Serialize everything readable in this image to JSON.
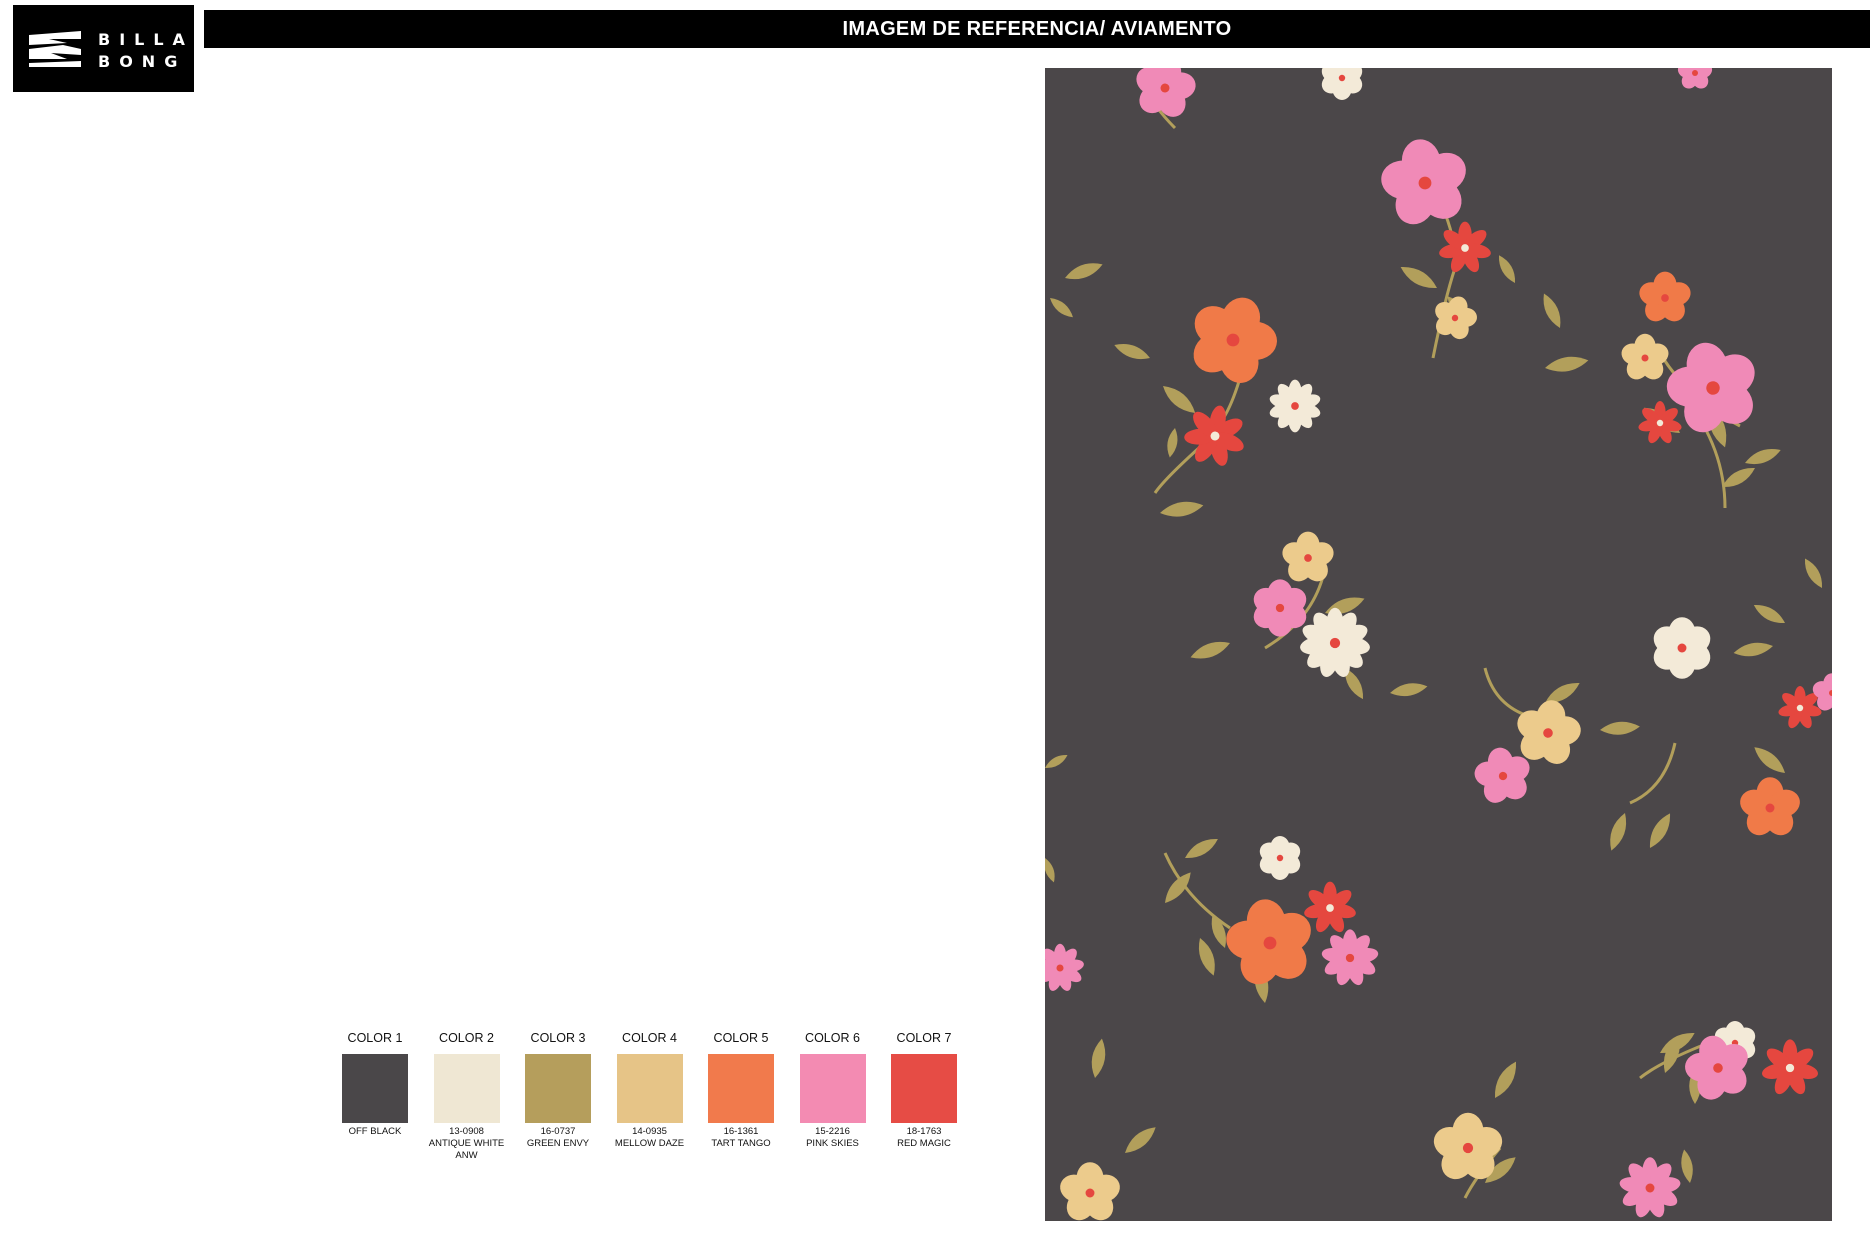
{
  "brand": {
    "logo_lines": [
      "BILLA",
      "BONG"
    ]
  },
  "header": {
    "title": "IMAGEM DE REFERENCIA/ AVIAMENTO"
  },
  "swatches": [
    {
      "label": "COLOR 1",
      "code": "",
      "name": "OFF BLACK",
      "name2": "",
      "color": "#4a4749"
    },
    {
      "label": "COLOR 2",
      "code": "13-0908",
      "name": "ANTIQUE WHITE",
      "name2": "ANW",
      "color": "#efe7d3"
    },
    {
      "label": "COLOR 3",
      "code": "16-0737",
      "name": "GREEN ENVY",
      "name2": "",
      "color": "#b59e5c"
    },
    {
      "label": "COLOR 4",
      "code": "14-0935",
      "name": "MELLOW DAZE",
      "name2": "",
      "color": "#e6c487"
    },
    {
      "label": "COLOR 5",
      "code": "16-1361",
      "name": "TART TANGO",
      "name2": "",
      "color": "#f17a4c"
    },
    {
      "label": "COLOR 6",
      "code": "15-2216",
      "name": "PINK SKIES",
      "name2": "",
      "color": "#f38bb2"
    },
    {
      "label": "COLOR 7",
      "code": "18-1763",
      "name": "RED MAGIC",
      "name2": "",
      "color": "#e64c45"
    }
  ],
  "print": {
    "background": "#4b4749",
    "colors": {
      "pink": "#f08ab7",
      "orange": "#f07a48",
      "red": "#e5473f",
      "cream": "#f3ead8",
      "yellow": "#eccb8c",
      "leaf": "#b29f5b"
    }
  }
}
